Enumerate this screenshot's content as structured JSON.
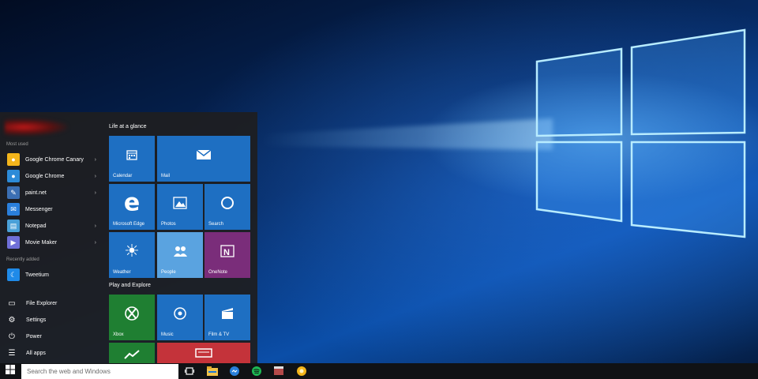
{
  "desktop": {
    "wallpaper": "Windows 10 hero wallpaper",
    "accent": "#1f7ad6"
  },
  "start_menu": {
    "most_used_label": "Most used",
    "apps": [
      {
        "label": "Google Chrome Canary",
        "icon": "chrome-canary-icon",
        "color": "#f3b51b",
        "has_submenu": true
      },
      {
        "label": "Google Chrome",
        "icon": "chrome-icon",
        "color": "#2c8bd8",
        "has_submenu": true
      },
      {
        "label": "paint.net",
        "icon": "paintnet-icon",
        "color": "#3b6fb3",
        "has_submenu": true
      },
      {
        "label": "Messenger",
        "icon": "messenger-icon",
        "color": "#2a7fdb",
        "has_submenu": false
      },
      {
        "label": "Notepad",
        "icon": "notepad-icon",
        "color": "#4aa0d8",
        "has_submenu": true
      },
      {
        "label": "Movie Maker",
        "icon": "movie-maker-icon",
        "color": "#6f6fd8",
        "has_submenu": true
      }
    ],
    "recently_added_label": "Recently added",
    "recent_apps": [
      {
        "label": "Tweetium",
        "icon": "tweetium-icon",
        "color": "#1f8ae8"
      }
    ],
    "system_items": [
      {
        "label": "File Explorer",
        "icon": "file-explorer-icon"
      },
      {
        "label": "Settings",
        "icon": "settings-icon"
      },
      {
        "label": "Power",
        "icon": "power-icon"
      },
      {
        "label": "All apps",
        "icon": "all-apps-icon"
      }
    ],
    "groups": [
      {
        "label": "Life at a glance",
        "tiles": [
          {
            "label": "Calendar",
            "icon": "calendar-icon",
            "color": "#1e6fc2"
          },
          {
            "label": "Mail",
            "icon": "mail-icon",
            "color": "#1e6fc2"
          },
          {
            "label": "Microsoft Edge",
            "icon": "edge-icon",
            "color": "#1e6fc2"
          },
          {
            "label": "Photos",
            "icon": "photos-icon",
            "color": "#1e6fc2"
          },
          {
            "label": "Search",
            "icon": "search-icon",
            "color": "#1e6fc2"
          },
          {
            "label": "Weather",
            "icon": "weather-icon",
            "color": "#1e6fc2"
          },
          {
            "label": "People",
            "icon": "people-icon",
            "color": "#5aa3e0"
          },
          {
            "label": "OneNote",
            "icon": "onenote-icon",
            "color": "#7a2d7a"
          }
        ]
      },
      {
        "label": "Play and Explore",
        "tiles": [
          {
            "label": "Xbox",
            "icon": "xbox-icon",
            "color": "#1f7f32"
          },
          {
            "label": "Music",
            "icon": "music-icon",
            "color": "#1e6fc2"
          },
          {
            "label": "Film & TV",
            "icon": "film-tv-icon",
            "color": "#1e6fc2"
          },
          {
            "label": "",
            "icon": "money-icon",
            "color": "#1f7f32"
          },
          {
            "label": "",
            "icon": "news-icon",
            "color": "#c4333a"
          }
        ]
      }
    ]
  },
  "taskbar": {
    "start_icon": "windows-logo-icon",
    "search_placeholder": "Search the web and Windows",
    "pinned": [
      {
        "icon": "task-view-icon",
        "color": "#ffffff"
      },
      {
        "icon": "file-explorer-icon",
        "color": "#f2c44a"
      },
      {
        "icon": "messenger-icon",
        "color": "#2a7fdb"
      },
      {
        "icon": "spotify-icon",
        "color": "#1db954"
      },
      {
        "icon": "movie-maker-icon",
        "color": "#b44a4a"
      },
      {
        "icon": "chrome-canary-icon",
        "color": "#f3b51b"
      }
    ]
  }
}
